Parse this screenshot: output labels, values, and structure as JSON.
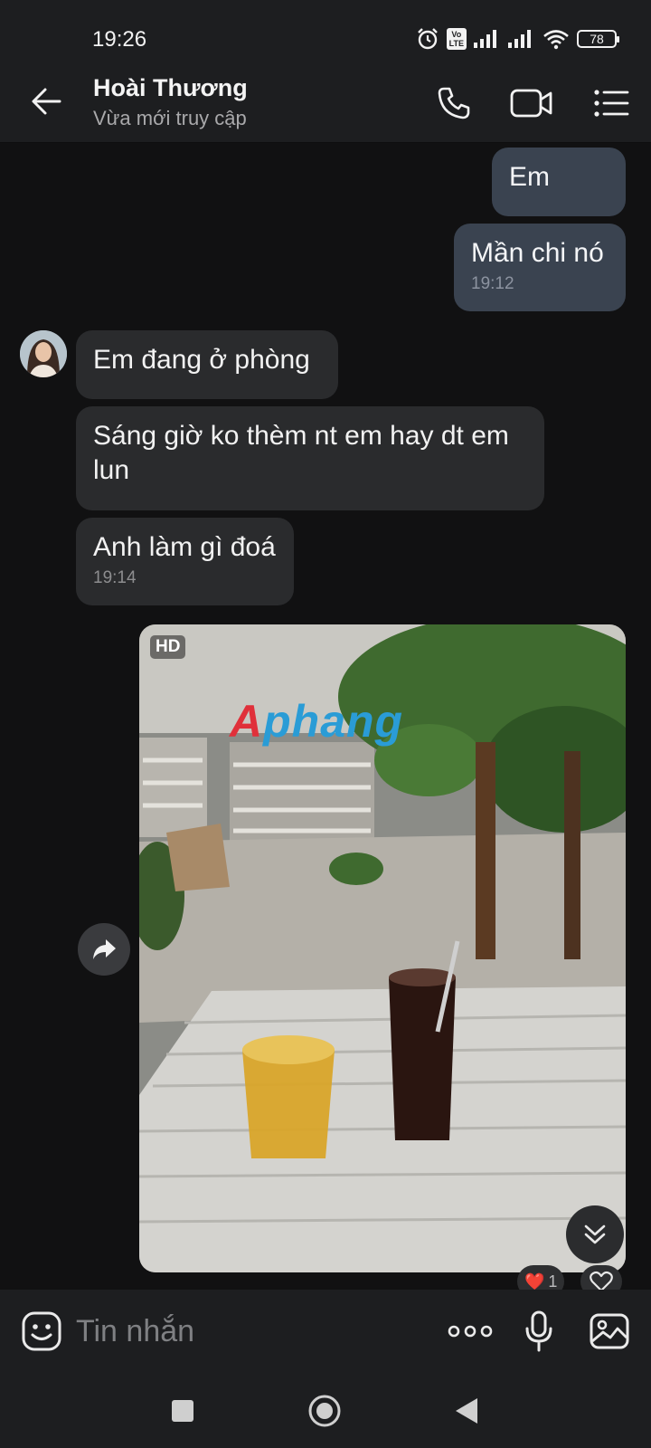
{
  "status_bar": {
    "time": "19:26",
    "battery": "78",
    "volte_label": "Vo LTE"
  },
  "header": {
    "contact_name": "Hoài Thương",
    "contact_status": "Vừa mới truy cập"
  },
  "messages": {
    "sent_1": {
      "text": "Em"
    },
    "sent_2": {
      "text": "Mần chi nó",
      "time": "19:12"
    },
    "recv_1": {
      "text": "Em đang ở phòng"
    },
    "recv_2": {
      "text": "Sáng giờ ko thèm nt em hay dt em lun"
    },
    "recv_3": {
      "text": "Anh làm gì đoá",
      "time": "19:14"
    }
  },
  "photo": {
    "quality_badge": "HD",
    "watermark": "Aphang"
  },
  "reaction": {
    "emoji": "❤️",
    "count": "1"
  },
  "composer": {
    "placeholder": "Tin nhắn"
  },
  "icons": {
    "back": "arrow-left-icon",
    "call": "phone-icon",
    "video": "video-camera-icon",
    "menu": "list-icon",
    "forward": "share-arrow-icon",
    "scroll": "double-chevron-down-icon",
    "heart": "heart-icon",
    "emoji": "emoji-face-icon",
    "more": "more-dots-icon",
    "mic": "microphone-icon",
    "gallery": "image-icon"
  },
  "colors": {
    "background": "#111112",
    "sent_bubble": "#3a4350",
    "received_bubble": "#2a2b2d",
    "bars": "#1d1e20"
  }
}
